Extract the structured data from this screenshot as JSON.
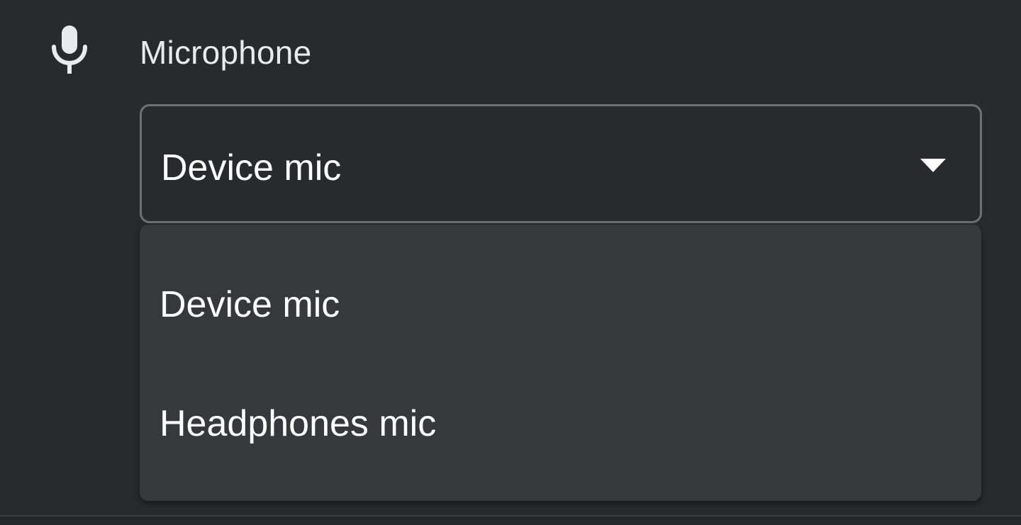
{
  "section": {
    "icon": "microphone-icon",
    "title": "Microphone"
  },
  "select": {
    "selected_value": "Device mic",
    "expanded": true,
    "chevron_icon": "chevron-down-icon"
  },
  "dropdown": {
    "options": [
      {
        "label": "Device mic"
      },
      {
        "label": "Headphones mic"
      }
    ]
  },
  "colors": {
    "background": "#292a2d",
    "menu_background": "#37383b",
    "border": "#6f7073",
    "text_primary": "#ffffff",
    "text_secondary": "#e8eaed"
  }
}
